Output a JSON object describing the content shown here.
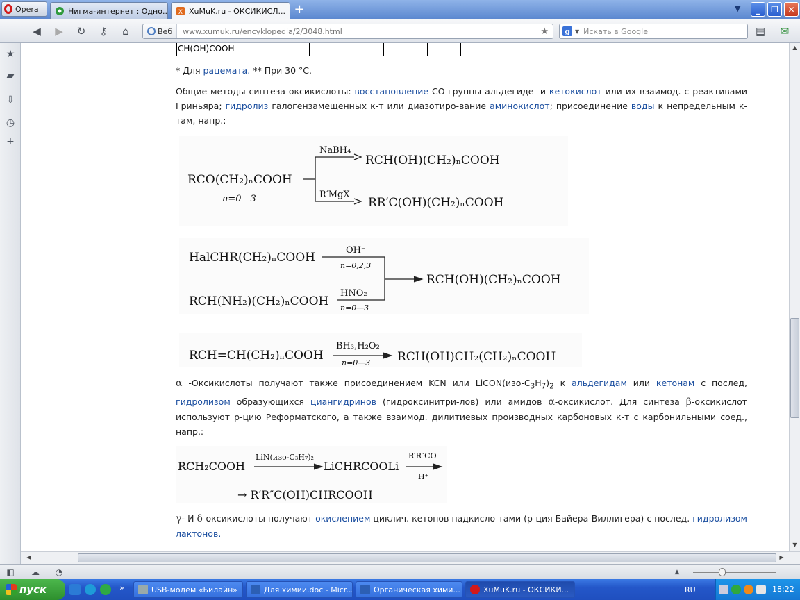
{
  "browser": {
    "menu_label": "Opera",
    "tabs": [
      {
        "title": "Нигма-интернет : Одно...",
        "close": "✕"
      },
      {
        "title": "XuMuK.ru - ОКСИКИСЛ...",
        "close": "✕"
      }
    ],
    "new_tab": "+",
    "address": {
      "badge": "Веб",
      "url_prefix": "www.xumuk.ru",
      "url_path": "/encyklopedia/2/3048.html"
    },
    "search_placeholder": "Искать в Google"
  },
  "page": {
    "table_fragment": "CH(OH)COOH",
    "footnote": {
      "p1": "* Для ",
      "link": "рацемата.",
      "p2": " ** При 30 °С."
    },
    "para1": {
      "t1": "Общие методы синтеза оксикислоты: ",
      "l1": "восстановление",
      "t2": " СО-группы альдегиде- и ",
      "l2": "кетокислот",
      "t3": " или их взаимод. с реактивами Гриньяра; ",
      "l3": "гидролиз",
      "t4": " галогензамещенных к-т или диазотиро-вание ",
      "l4": "аминокислот",
      "t5": "; присоединение ",
      "l5": "воды",
      "t6": " к непредельным к-там, напр.:"
    },
    "para2": {
      "alpha": "α",
      "t1": " -Оксикислоты получают также присоединением KCN или LiCON(изо-C",
      "s1": "3",
      "t1b": "H",
      "s2": "7",
      "t1c": ")",
      "s3": "2",
      "t1d": " к ",
      "l1": "альдегидам",
      "t2": " или ",
      "l2": "кетонам",
      "t3": " с послед, ",
      "l3": "гидролизом",
      "t4": " образующихся ",
      "l4": "циангидринов",
      "t5": " (гидроксинитри-лов) или амидов ",
      "alpha2": "α",
      "t6": "-оксикислот. Для синтеза ",
      "beta": "β",
      "t7": "-оксикислот используют р-цию Реформатского, а также взаимод. дилитиевых производных карбоновых к-т с карбонильными соед., напр.:"
    },
    "para3": {
      "gamma": "γ-",
      "t1": " И ",
      "delta": "δ",
      "t2": "-оксикислоты получают ",
      "l1": "окислением",
      "t3": " циклич. кетонов надкисло-тами (р-ция Байера-Виллигера) с послед. ",
      "l2": "гидролизом лактонов."
    },
    "scheme1": {
      "reagent": "RCO(CH₂)ₙCOOH",
      "cond": "n=0—3",
      "arrow1": "NaBH₄",
      "prod1": "RCH(OH)(CH₂)ₙCOOH",
      "arrow2": "R′MgX",
      "prod2": "RR′C(OH)(CH₂)ₙCOOH"
    },
    "scheme2": {
      "r1": "HalCHR(CH₂)ₙCOOH",
      "c1": "OH⁻",
      "n1": "n=0,2,3",
      "r2": "RCH(NH₂)(CH₂)ₙCOOH",
      "c2": "HNO₂",
      "n2": "n=0—3",
      "prod": "RCH(OH)(CH₂)ₙCOOH"
    },
    "scheme3": {
      "r": "RCH=CH(CH₂)ₙCOOH",
      "c": "BH₃,H₂O₂",
      "n": "n=0—3",
      "prod": "RCH(OH)CH₂(CH₂)ₙCOOH"
    },
    "scheme4": {
      "r": "RCH₂COOH",
      "c1": "LiN(изо-C₃H₇)₂",
      "mid": "LiCHRCOOLi",
      "c2": "R′R″CO",
      "c3": "H⁺",
      "prod": "→ R′R″C(OH)CHRCOOH"
    }
  },
  "statusbar": {
    "zoom_slider_level": 0.35
  },
  "taskbar": {
    "start": "пуск",
    "tasks": [
      "USB-модем «Билайн»",
      "Для химии.doc - Micr...",
      "Органическая хими...",
      "XuMuK.ru - ОКСИКИ..."
    ],
    "lang": "RU",
    "clock": "18:22"
  }
}
